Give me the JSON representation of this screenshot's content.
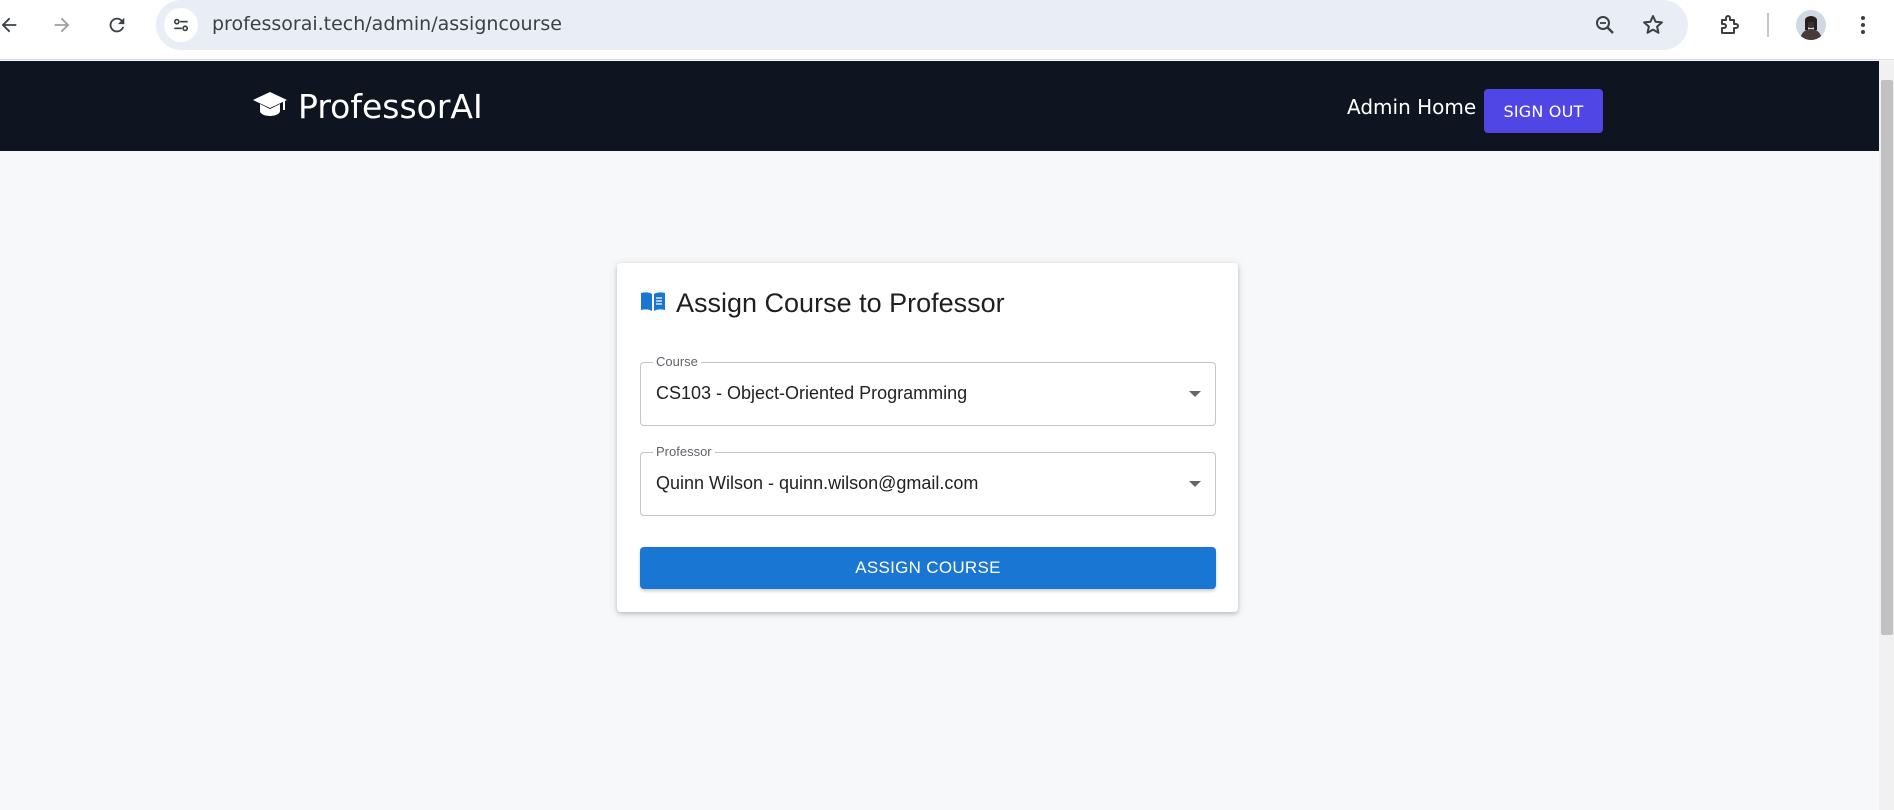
{
  "browser": {
    "url": "professorai.tech/admin/assigncourse",
    "icons": [
      "back-arrow-icon",
      "forward-arrow-icon",
      "reload-icon",
      "site-settings-icon",
      "zoom-icon",
      "bookmark-star-icon",
      "extensions-icon",
      "profile-avatar",
      "more-menu-icon"
    ]
  },
  "header": {
    "brand": "ProfessorAI",
    "brand_icon": "graduation-cap-icon",
    "nav_link": "Admin Home",
    "signout_label": "SIGN OUT"
  },
  "form": {
    "title": "Assign Course to Professor",
    "title_icon": "open-book-icon",
    "course_label": "Course",
    "course_value": "CS103 - Object-Oriented Programming",
    "professor_label": "Professor",
    "professor_value": "Quinn Wilson - quinn.wilson@gmail.com",
    "submit_label": "ASSIGN COURSE"
  },
  "colors": {
    "header_bg": "#0f1520",
    "signout_bg": "#4f46e5",
    "primary": "#1976d2",
    "page_bg": "#f7f8fa"
  }
}
